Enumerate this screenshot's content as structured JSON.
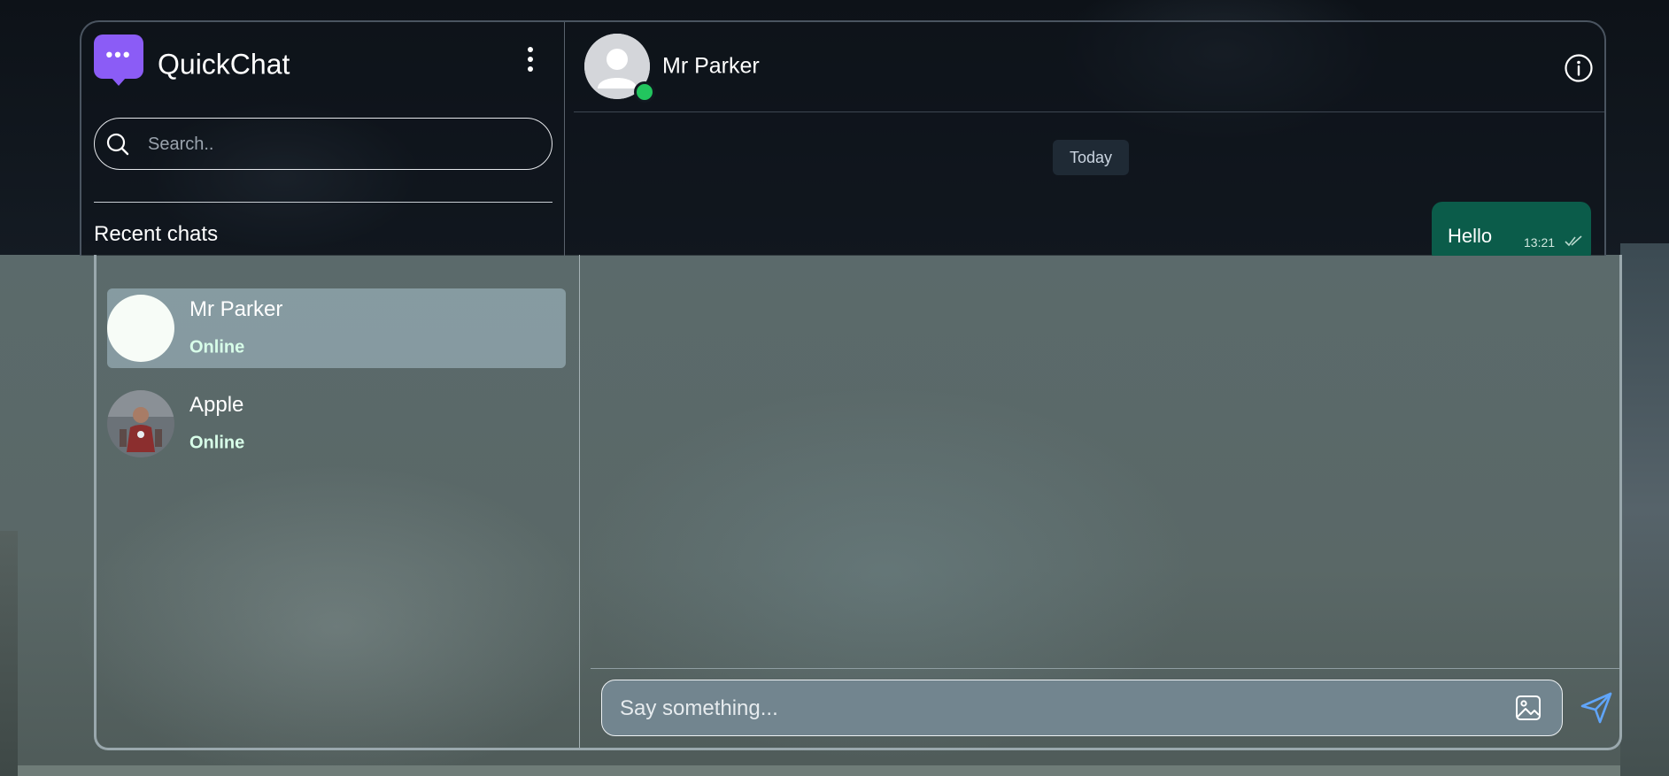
{
  "app": {
    "title": "QuickChat",
    "logo_icon": "chat-bubble-icon",
    "accent": "#8b5cf6"
  },
  "sidebar": {
    "menu_icon": "kebab-menu-icon",
    "search": {
      "placeholder": "Search..",
      "icon": "search-icon"
    },
    "recent_label": "Recent chats",
    "chats": [
      {
        "name": "Mr Parker",
        "status": "Online",
        "active": true
      },
      {
        "name": "Apple",
        "status": "Online",
        "active": false
      }
    ]
  },
  "chat": {
    "contact_name": "Mr Parker",
    "online": true,
    "info_icon": "info-icon",
    "date_separator": "Today",
    "messages": [
      {
        "text": "Hello",
        "time": "13:21",
        "outgoing": true,
        "status": "read"
      }
    ],
    "composer": {
      "placeholder": "Say something...",
      "attach_icon": "image-icon",
      "send_icon": "send-icon"
    }
  },
  "colors": {
    "online": "#22c55e",
    "outgoing_bubble": "#0b5c4a",
    "send": "#60a5fa"
  }
}
